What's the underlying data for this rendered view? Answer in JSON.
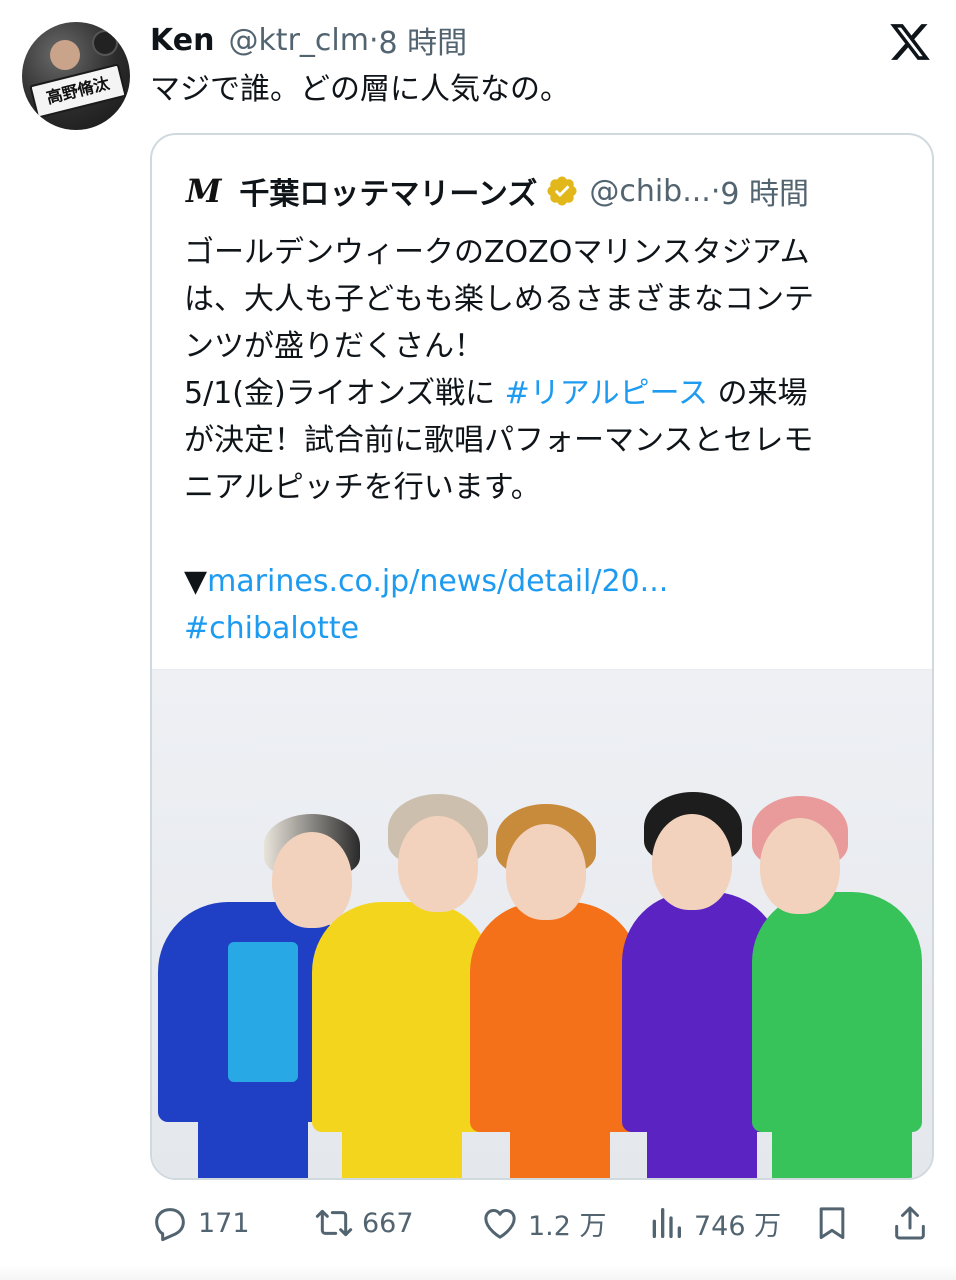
{
  "author": {
    "name": "Ken",
    "handle": "@ktr_clm",
    "dot": "·",
    "time": "8 時間",
    "avatar_icon": "user-avatar"
  },
  "tweet": {
    "text": "マジで誰。どの層に人気なの。"
  },
  "brand_icon": "x-logo-icon",
  "quote": {
    "logo": "M",
    "name": "千葉ロッテマリーンズ",
    "verified_icon": "verified-badge-icon",
    "handle": "@chib...",
    "dot": "·",
    "time": "9 時間",
    "lines": {
      "l1": "ゴールデンウィークのZOZOマリンスタジアム",
      "l2": "は、大人も子どもも楽しめるさまざまなコンテ",
      "l3": "ンツが盛りだくさん！",
      "l4_pre": "5/1(金)ライオンズ戦に ",
      "l4_tag": "#リアルピース",
      "l4_post": " の来場",
      "l5": "が決定！試合前に歌唱パフォーマンスとセレモ",
      "l6": "ニアルピッチを行います。",
      "l8_arrow": "▼",
      "l8_link": "marines.co.jp/news/detail/20...",
      "l9_tag": "#chibalotte"
    },
    "photo_alt": "group-photo"
  },
  "actions": {
    "reply_count": "171",
    "retweet_count": "667",
    "like_count": "1.2 万",
    "view_count": "746 万"
  },
  "colors": {
    "text": "#0f1419",
    "secondary": "#536471",
    "link": "#1d9bf0",
    "border": "#cfd9de",
    "verified": "#e2b719"
  }
}
